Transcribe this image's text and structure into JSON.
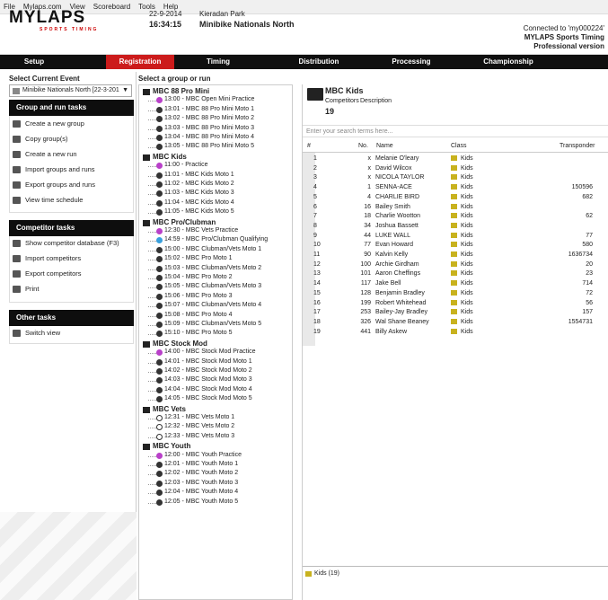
{
  "menu": [
    "File",
    "Mylaps.com",
    "View",
    "Scoreboard",
    "Tools",
    "Help"
  ],
  "header": {
    "brand": "MYLAPS",
    "brand_sub": "SPORTS TIMING",
    "date": "22-9-2014",
    "time": "16:34:15",
    "venue": "Kieradan Park",
    "event": "Minibike Nationals North",
    "connected": "Connected to 'my000224'",
    "product": "MYLAPS Sports Timing",
    "edition": "Professional version"
  },
  "nav": [
    "Setup",
    "Registration",
    "Timing",
    "Distribution",
    "Processing",
    "Championship"
  ],
  "left": {
    "select_event_label": "Select Current Event",
    "event_value": "Minibike Nationals North  [22-3-201",
    "group_tasks_title": "Group and run tasks",
    "group_tasks": [
      "Create a new group",
      "Copy group(s)",
      "Create a new run",
      "Import groups and runs",
      "Export groups and runs",
      "View time schedule"
    ],
    "competitor_tasks_title": "Competitor tasks",
    "competitor_tasks": [
      "Show competitor database (F3)",
      "Import competitors",
      "Export competitors",
      "Print"
    ],
    "other_tasks_title": "Other tasks",
    "other_tasks": [
      "Switch view"
    ]
  },
  "tree": {
    "label": "Select a group or run",
    "groups": [
      {
        "name": "MBC 88 Pro Mini",
        "runs": [
          {
            "t": "13:00 - MBC Open Mini Practice",
            "k": "practice"
          },
          {
            "t": "13:01 - MBC 88 Pro Mini Moto 1",
            "k": "race"
          },
          {
            "t": "13:02 - MBC 88 Pro Mini Moto 2",
            "k": "race"
          },
          {
            "t": "13:03 - MBC 88 Pro Mini Moto 3",
            "k": "race"
          },
          {
            "t": "13:04 - MBC 88 Pro Mini Moto 4",
            "k": "race"
          },
          {
            "t": "13:05 - MBC 88 Pro Mini Moto 5",
            "k": "race"
          }
        ]
      },
      {
        "name": "MBC Kids",
        "runs": [
          {
            "t": "11:00 - Practice",
            "k": "practice"
          },
          {
            "t": "11:01 - MBC Kids Moto 1",
            "k": "race"
          },
          {
            "t": "11:02 - MBC Kids Moto 2",
            "k": "race"
          },
          {
            "t": "11:03 - MBC Kids Moto 3",
            "k": "race"
          },
          {
            "t": "11:04 - MBC Kids Moto 4",
            "k": "race"
          },
          {
            "t": "11:05 - MBC Kids Moto 5",
            "k": "race"
          }
        ]
      },
      {
        "name": "MBC Pro/Clubman",
        "runs": [
          {
            "t": "12:30 - MBC Vets Practice",
            "k": "practice"
          },
          {
            "t": "14:59 - MBC Pro/Clubman Qualifying",
            "k": "qual"
          },
          {
            "t": "15:00 - MBC Clubman/Vets Moto 1",
            "k": "race"
          },
          {
            "t": "15:02 - MBC Pro Moto 1",
            "k": "race"
          },
          {
            "t": "15:03 - MBC Clubman/Vets Moto 2",
            "k": "race"
          },
          {
            "t": "15:04 - MBC Pro Moto 2",
            "k": "race"
          },
          {
            "t": "15:05 - MBC Clubman/Vets Moto 3",
            "k": "race"
          },
          {
            "t": "15:06 - MBC Pro Moto 3",
            "k": "race"
          },
          {
            "t": "15:07 - MBC Clubman/Vets Moto 4",
            "k": "race"
          },
          {
            "t": "15:08 - MBC Pro Moto 4",
            "k": "race"
          },
          {
            "t": "15:09 - MBC Clubman/Vets Moto 5",
            "k": "race"
          },
          {
            "t": "15:10 - MBC Pro Moto 5",
            "k": "race"
          }
        ]
      },
      {
        "name": "MBC Stock Mod",
        "runs": [
          {
            "t": "14:00 - MBC Stock Mod Practice",
            "k": "practice"
          },
          {
            "t": "14:01 - MBC Stock Mod Moto 1",
            "k": "race"
          },
          {
            "t": "14:02 - MBC Stock Mod Moto 2",
            "k": "race"
          },
          {
            "t": "14:03 - MBC Stock Mod Moto 3",
            "k": "race"
          },
          {
            "t": "14:04 - MBC Stock Mod Moto 4",
            "k": "race"
          },
          {
            "t": "14:05 - MBC Stock Mod Moto 5",
            "k": "race"
          }
        ]
      },
      {
        "name": "MBC Vets",
        "runs": [
          {
            "t": "12:31 - MBC Vets Moto 1",
            "k": "empty"
          },
          {
            "t": "12:32 - MBC Vets Moto 2",
            "k": "empty"
          },
          {
            "t": "12:33 - MBC Vets Moto 3",
            "k": "empty"
          }
        ]
      },
      {
        "name": "MBC Youth",
        "runs": [
          {
            "t": "12:00 - MBC Youth Practice",
            "k": "practice"
          },
          {
            "t": "12:01 - MBC Youth Moto 1",
            "k": "race"
          },
          {
            "t": "12:02 - MBC Youth Moto 2",
            "k": "race"
          },
          {
            "t": "12:03 - MBC Youth Moto 3",
            "k": "race"
          },
          {
            "t": "12:04 - MBC Youth Moto 4",
            "k": "race"
          },
          {
            "t": "12:05 - MBC Youth Moto 5",
            "k": "race"
          }
        ]
      }
    ]
  },
  "group": {
    "title": "MBC Kids",
    "competitors_label": "Competitors",
    "description_label": "Description",
    "competitors": "19",
    "search_placeholder": "Enter your search terms here...",
    "columns": [
      "#",
      "No.",
      "Name",
      "Class",
      "Transponder"
    ],
    "rows": [
      [
        "1",
        "x",
        "Melanie O'leary",
        "Kids",
        ""
      ],
      [
        "2",
        "x",
        "David Wilcox",
        "Kids",
        ""
      ],
      [
        "3",
        "x",
        "NICOLA TAYLOR",
        "Kids",
        ""
      ],
      [
        "4",
        "1",
        "SENNA-ACE",
        "Kids",
        "150596"
      ],
      [
        "5",
        "4",
        "CHARLIE BIRD",
        "Kids",
        "682"
      ],
      [
        "6",
        "16",
        "Bailey Smith",
        "Kids",
        ""
      ],
      [
        "7",
        "18",
        "Charlie Wootton",
        "Kids",
        "62"
      ],
      [
        "8",
        "34",
        "Joshua Bassett",
        "Kids",
        ""
      ],
      [
        "9",
        "44",
        "LUKE WALL",
        "Kids",
        "77"
      ],
      [
        "10",
        "77",
        "Evan Howard",
        "Kids",
        "580"
      ],
      [
        "11",
        "90",
        "Kalvin Kelly",
        "Kids",
        "1636734"
      ],
      [
        "12",
        "100",
        "Archie Girdham",
        "Kids",
        "20"
      ],
      [
        "13",
        "101",
        "Aaron Cheffings",
        "Kids",
        "23"
      ],
      [
        "14",
        "117",
        "Jake Bell",
        "Kids",
        "714"
      ],
      [
        "15",
        "128",
        "Benjamin Bradley",
        "Kids",
        "72"
      ],
      [
        "16",
        "199",
        "Robert Whitehead",
        "Kids",
        "56"
      ],
      [
        "17",
        "253",
        "Bailey-Jay Bradley",
        "Kids",
        "157"
      ],
      [
        "18",
        "326",
        "Wal Shane Beaney",
        "Kids",
        "1554731"
      ],
      [
        "19",
        "441",
        "Billy Askew",
        "Kids",
        ""
      ]
    ],
    "footer": "Kids (19)"
  }
}
